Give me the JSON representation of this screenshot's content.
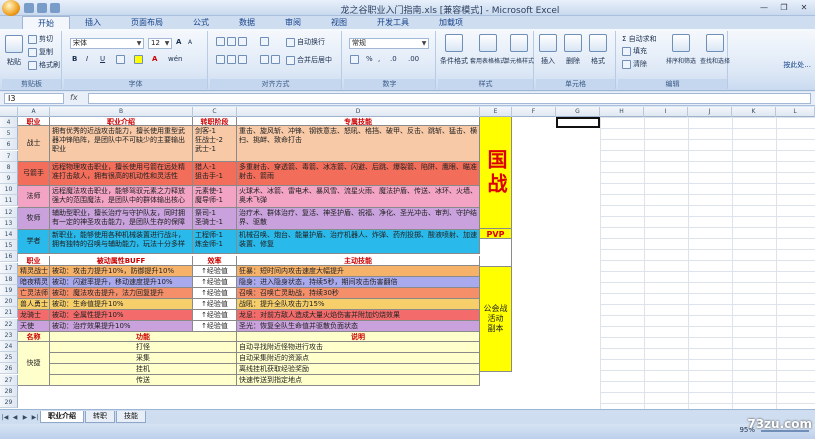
{
  "window": {
    "title": "龙之谷职业入门指南.xls [兼容模式] - Microsoft Excel",
    "controls": [
      "—",
      "❐",
      "✕"
    ]
  },
  "ribbon_tabs": [
    "开始",
    "插入",
    "页面布局",
    "公式",
    "数据",
    "审阅",
    "视图",
    "开发工具",
    "加载项"
  ],
  "ribbon": {
    "clipboard": {
      "label": "剪贴板",
      "paste": "粘贴",
      "cut": "剪切",
      "copy": "复制",
      "format_painter": "格式刷"
    },
    "font": {
      "label": "字体",
      "font_name": "宋体",
      "font_size": "12",
      "bold": "B",
      "italic": "I",
      "underline": "U",
      "grow": "A",
      "shrink": "A",
      "wen": "wén"
    },
    "alignment": {
      "label": "对齐方式",
      "wrap": "自动换行",
      "merge": "合并后居中"
    },
    "number": {
      "label": "数字",
      "format": "常规",
      "percent": "%",
      "comma": ",",
      "increase": ".0",
      "decrease": ".00"
    },
    "styles": {
      "label": "样式",
      "conditional": "条件格式",
      "table": "套用表格格式",
      "cell": "单元格样式"
    },
    "cells": {
      "label": "单元格",
      "insert": "插入",
      "delete": "删除",
      "format": "格式"
    },
    "editing": {
      "label": "编辑",
      "sum": "Σ 自动求和",
      "fill": "填充",
      "clear": "清除",
      "sort": "排序和筛选",
      "find": "查找和选择"
    }
  },
  "help_area": "按此处...",
  "formula_bar": {
    "name_box": "I3",
    "fx": "fx",
    "formula": ""
  },
  "columns": [
    "A",
    "B",
    "C",
    "D",
    "E",
    "F",
    "G",
    "H",
    "I",
    "J",
    "K",
    "L"
  ],
  "row_numbers": [
    "4",
    "5",
    "6",
    "7",
    "8",
    "9",
    "10",
    "11",
    "12",
    "13",
    "14",
    "15",
    "16",
    "17",
    "18",
    "19",
    "20",
    "21",
    "22",
    "23",
    "24",
    "25",
    "26",
    "27",
    "28",
    "29"
  ],
  "top_table": {
    "headers": [
      "职业",
      "职业介绍",
      "转职阶段",
      "专属技能"
    ],
    "rows": [
      {
        "name": "战士",
        "intro": "拥有优秀的近战攻击能力，擅长使用重型武器冲锋陷阵，是团队中不可缺少的主要输出职业",
        "stages": "剑客-1\n狂战士-2\n武士-1",
        "skills": "重击、旋风斩、冲锋、钢铁意志、怒吼、格挡、破甲、反击、跳斩、猛击、横扫、挑衅、致命打击",
        "color": "#f7c9a7"
      },
      {
        "name": "弓箭手",
        "intro": "远程物理攻击职业，擅长使用弓箭在远处精准打击敌人，拥有很高的机动性和灵活性",
        "stages": "猎人-1\n狙击手-1",
        "skills": "多重射击、穿透箭、毒箭、冰冻箭、闪避、后跳、爆裂箭、陷阱、鹰眼、瞄准射击、箭雨",
        "color": "#f26d5a"
      },
      {
        "name": "法师",
        "intro": "远程魔法攻击职业，能够驾驭元素之力释放强大的范围魔法，是团队中的群体输出核心",
        "stages": "元素使-1\n魔导师-1",
        "skills": "火球术、冰箭、雷电术、暴风雪、流星火雨、魔法护盾、传送、冰环、火墙、奥术飞弹",
        "color": "#f3a3c4"
      },
      {
        "name": "牧师",
        "intro": "辅助型职业，擅长治疗与守护队友，同时拥有一定的神圣攻击能力，是团队生存的保障",
        "stages": "祭司-1\n圣骑士-1",
        "skills": "治疗术、群体治疗、复活、神圣护盾、祝福、净化、圣光冲击、审判、守护结界、驱散",
        "color": "#c9a2dd"
      },
      {
        "name": "学者",
        "intro": "新职业，能够使用各种机械装置进行战斗，拥有独特的召唤与辅助能力，玩法十分多样",
        "stages": "工程师-1\n炼金师-1",
        "skills": "机械召唤、炮台、能量护盾、治疗机器人、炸弹、药剂投掷、酸液喷射、加速装置、修复",
        "color": "#29b9ea"
      }
    ]
  },
  "right_side": {
    "guozhan": "国战",
    "pvp": "PVP",
    "third": "公会战\n活动\n副本"
  },
  "bottom_table": {
    "headers": [
      "职业",
      "被动属性BUFF",
      "效率",
      "主动技能"
    ],
    "rows": [
      {
        "name": "精灵战士",
        "buff": "被动：攻击力提升10%，防御提升10%",
        "rate": "↑经验值",
        "skill": "狂暴：短时间内攻击速度大幅提升",
        "color": "#f7b26a"
      },
      {
        "name": "暗夜精灵",
        "buff": "被动：闪避率提升，移动速度提升10%",
        "rate": "↑经验值",
        "skill": "隐身：进入隐身状态，持续5秒，期间攻击伤害翻倍",
        "color": "#a9a9ee"
      },
      {
        "name": "亡灵法师",
        "buff": "被动：魔法攻击提升，法力回复提升",
        "rate": "↑经验值",
        "skill": "召唤：召唤亡灵助战，持续30秒",
        "color": "#f58f6a"
      },
      {
        "name": "兽人勇士",
        "buff": "被动：生命值提升10%",
        "rate": "↑经验值",
        "skill": "战吼：提升全队攻击力15%",
        "color": "#f7cf6a"
      },
      {
        "name": "龙骑士",
        "buff": "被动：全属性提升10%",
        "rate": "↑经验值",
        "skill": "龙息：对前方敌人造成大量火焰伤害并附加灼烧效果",
        "color": "#f36b6b"
      },
      {
        "name": "天使",
        "buff": "被动：治疗效果提升10%",
        "rate": "↑经验值",
        "skill": "圣光：恢复全队生命值并驱散负面状态",
        "color": "#c9a2dd"
      }
    ]
  },
  "misc_table": {
    "headers": [
      "名称",
      "功能",
      "说明"
    ],
    "group_name": "快捷",
    "rows": [
      {
        "func": "打怪",
        "desc": "自动寻找附近怪物进行攻击"
      },
      {
        "func": "采集",
        "desc": "自动采集附近的资源点"
      },
      {
        "func": "挂机",
        "desc": "离线挂机获取经验奖励"
      },
      {
        "func": "传送",
        "desc": "快速传送到指定地点"
      }
    ]
  },
  "sheet_tabs": [
    "职业介绍",
    "转职",
    "技能"
  ],
  "status": {
    "zoom": "95%"
  },
  "watermark": "73zu.com"
}
